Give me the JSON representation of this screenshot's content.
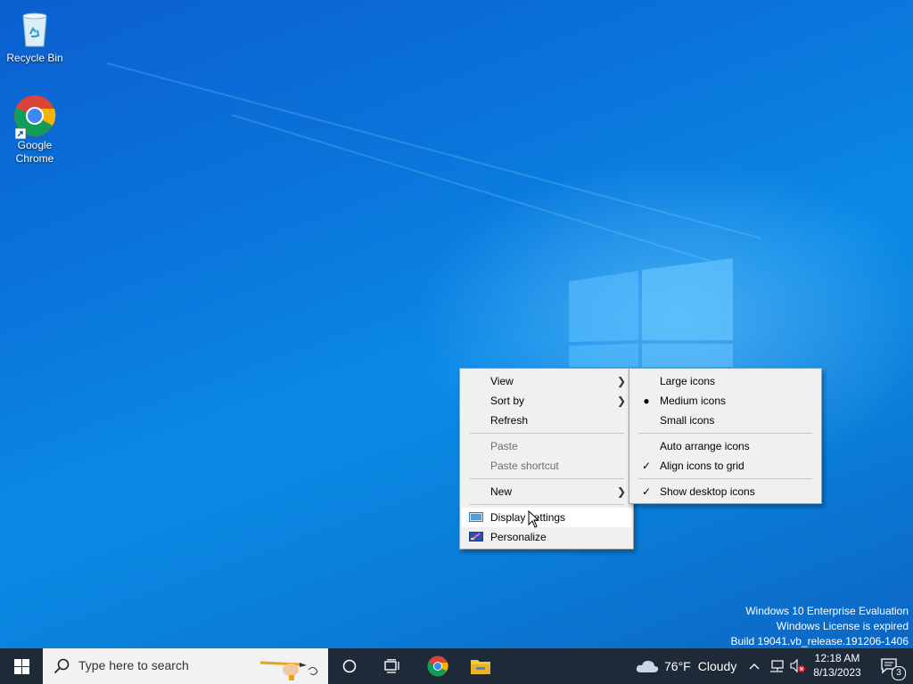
{
  "desktop": {
    "icons": [
      {
        "label": "Recycle Bin"
      },
      {
        "label": "Google Chrome"
      }
    ],
    "watermark": {
      "line1": "Windows 10 Enterprise Evaluation",
      "line2": "Windows License is expired",
      "line3": "Build 19041.vb_release.191206-1406"
    }
  },
  "context_menu": {
    "items": {
      "view": "View",
      "sort_by": "Sort by",
      "refresh": "Refresh",
      "paste": "Paste",
      "paste_shortcut": "Paste shortcut",
      "new": "New",
      "display_settings": "Display settings",
      "personalize": "Personalize"
    }
  },
  "view_submenu": {
    "items": {
      "large_icons": "Large icons",
      "medium_icons": "Medium icons",
      "small_icons": "Small icons",
      "auto_arrange": "Auto arrange icons",
      "align_to_grid": "Align icons to grid",
      "show_desktop_icons": "Show desktop icons"
    },
    "selected_size": "Medium icons",
    "checked": [
      "Align icons to grid",
      "Show desktop icons"
    ]
  },
  "taskbar": {
    "search_placeholder": "Type here to search",
    "weather": {
      "temp": "76°F",
      "condition": "Cloudy"
    },
    "clock": {
      "time": "12:18 AM",
      "date": "8/13/2023"
    },
    "notification_count": "3"
  },
  "colors": {
    "taskbar_bg": "#1e2a37",
    "menu_bg": "#f0f0f0",
    "desktop_blue": "#0a78dc"
  }
}
